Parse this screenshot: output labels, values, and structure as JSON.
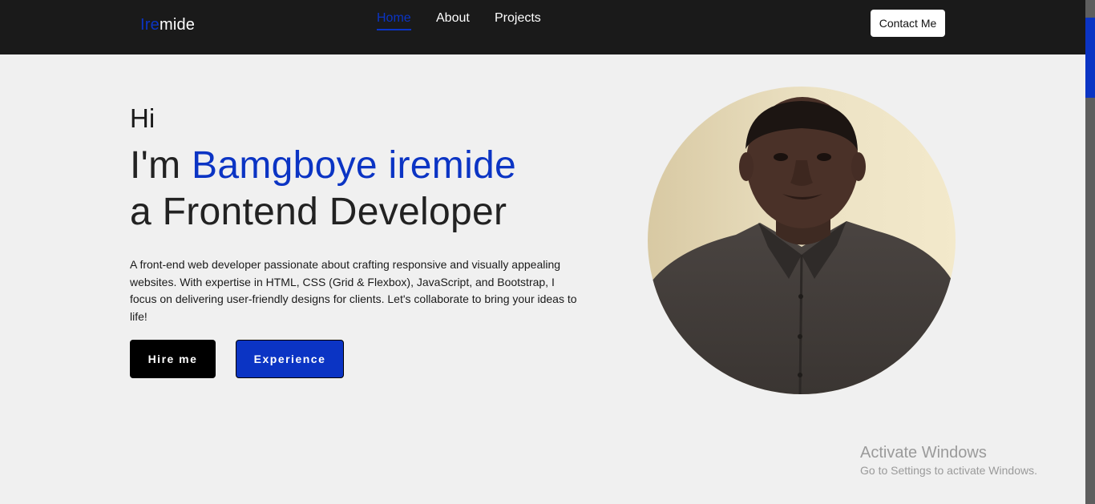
{
  "nav": {
    "logo_accent": "Ire",
    "logo_rest": "mide",
    "links": [
      "Home",
      "About",
      "Projects"
    ],
    "contact_label": "Contact Me"
  },
  "hero": {
    "greeting": "Hi",
    "intro": "I'm ",
    "name": "Bamgboye iremide",
    "role": "a Frontend Developer",
    "bio": "A front-end web developer passionate about crafting responsive and visually appealing websites. With expertise in HTML, CSS (Grid & Flexbox), JavaScript, and Bootstrap, I focus on delivering user-friendly designs for clients. Let's collaborate to bring your ideas to life!",
    "hire_label": "Hire me",
    "experience_label": "Experience"
  },
  "watermark": {
    "title": "Activate Windows",
    "subtitle": "Go to Settings to activate Windows."
  },
  "colors": {
    "accent": "#0b34c4",
    "navbar": "#1a1a1a",
    "background": "#f0f0f0"
  }
}
